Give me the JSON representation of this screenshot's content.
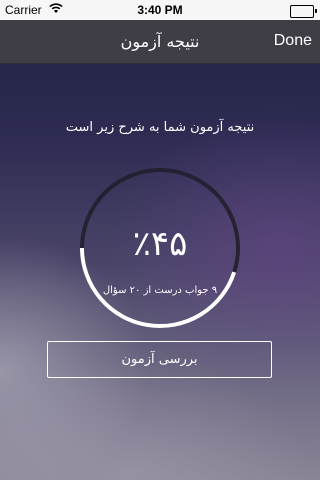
{
  "status_bar": {
    "carrier": "Carrier",
    "time": "3:40 PM",
    "battery_level": 1.0
  },
  "nav": {
    "title": "نتیجه آزمون",
    "done_label": "Done"
  },
  "result": {
    "heading": "نتیجه آزمون شما به شرح زیر است",
    "percent_text": "٪۴۵",
    "score_fraction": 0.45,
    "detail": "۹ جواب درست از ۲۰ سؤال"
  },
  "actions": {
    "review_label": "بررسی آزمون"
  },
  "colors": {
    "nav_background": "#3f3e47",
    "ring_track": "#1e1d2a",
    "ring_fill": "#ffffff"
  }
}
